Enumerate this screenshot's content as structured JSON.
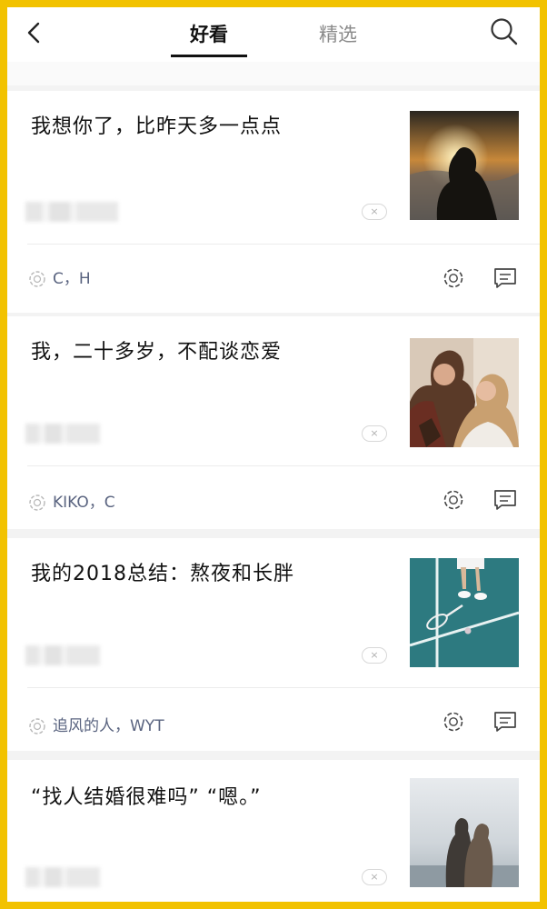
{
  "header": {
    "back_icon": "chevron-left-icon",
    "tabs": [
      {
        "label": "好看",
        "active": true
      },
      {
        "label": "精选",
        "active": false
      }
    ],
    "search_icon": "search-icon"
  },
  "colors": {
    "frame": "#f2c200",
    "names": "#5a6480",
    "title": "#111111"
  },
  "feed": [
    {
      "title": "我想你了，比昨天多一点点",
      "dismiss_label": "×",
      "likers": "C，H",
      "image": "silhouette at sunset"
    },
    {
      "title": "我，二十多岁，不配谈恋爱",
      "dismiss_label": "×",
      "likers": "KIKO，C",
      "image": "couple kissing"
    },
    {
      "title": "我的2018总结：熬夜和长胖",
      "dismiss_label": "×",
      "likers": "追风的人，WYT",
      "image": "tennis court"
    },
    {
      "title": "“找人结婚很难吗”  “嗯。”",
      "dismiss_label": "×",
      "image": "couple by the sea"
    }
  ]
}
